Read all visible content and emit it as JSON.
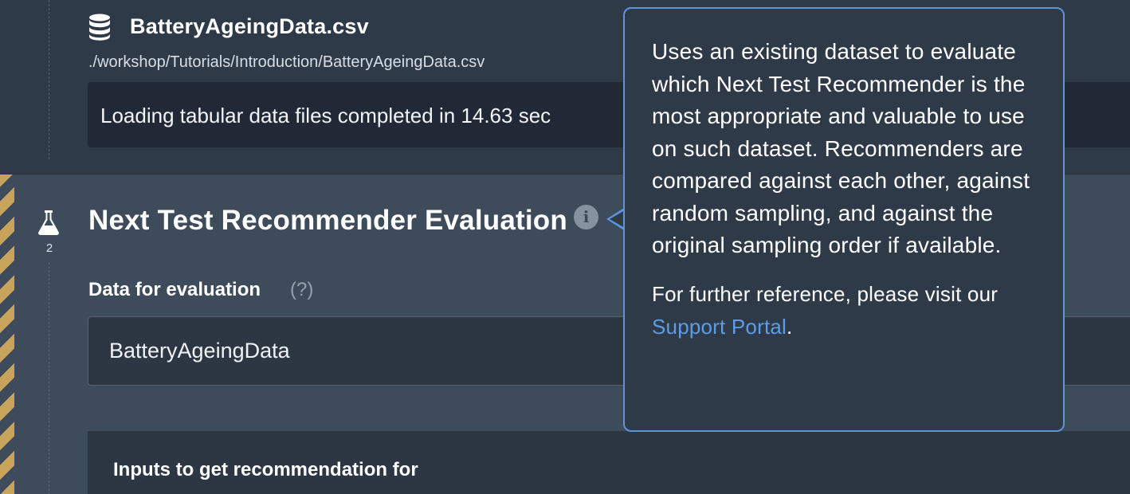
{
  "file_step": {
    "icon": "database-icon",
    "title": "BatteryAgeingData.csv",
    "path": "./workshop/Tutorials/Introduction/BatteryAgeingData.csv",
    "log_message": "Loading tabular data files completed in 14.63 sec"
  },
  "evaluation_step": {
    "icon": "flask-icon",
    "step_number": "2",
    "title": "Next Test Recommender Evaluation",
    "info_icon": "info-icon",
    "data_field": {
      "label": "Data for evaluation",
      "help_hint": "(?)",
      "value": "BatteryAgeingData"
    },
    "inputs_section": {
      "title": "Inputs to get recommendation for"
    }
  },
  "tooltip": {
    "body": "Uses an existing dataset to evaluate which Next Test Recommender is the most appropriate and valuable to use on such dataset. Recommenders are compared against each other, against random sampling, and against the original sampling order if available.",
    "reference_prefix": "For further reference, please visit our ",
    "link_label": "Support Portal",
    "reference_suffix": "."
  },
  "colors": {
    "accent_blue": "#5b95dc",
    "link_blue": "#5b9de6",
    "hazard_gold": "#c7a35b",
    "active_step_bg": "#3e4b5b",
    "dark_bg": "#2f3a48"
  }
}
